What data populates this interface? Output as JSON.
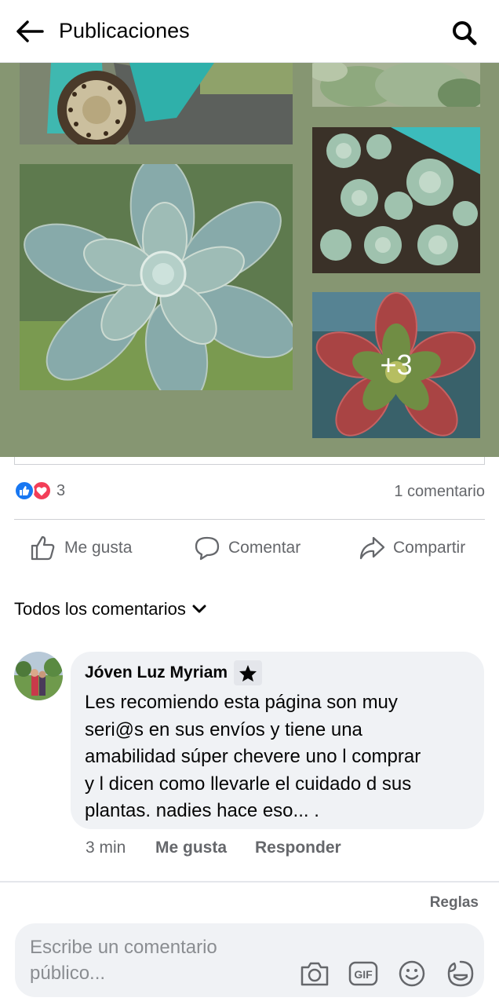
{
  "header": {
    "title": "Publicaciones"
  },
  "collage": {
    "more_label": "+3"
  },
  "post_stats": {
    "reaction_count": "3",
    "comment_count": "1 comentario"
  },
  "actions": {
    "like": "Me gusta",
    "comment": "Comentar",
    "share": "Compartir"
  },
  "comments_filter": {
    "label": "Todos los comentarios"
  },
  "comment": {
    "author": "Jóven Luz Myriam",
    "text": "Les recomiendo esta página son muy\nseri@s en sus envíos y tiene una\namabilidad  súper chevere uno l comprar\ny  l dicen como llevarle el cuidado d sus\nplantas. nadies hace eso... .",
    "time": "3 min",
    "like": "Me gusta",
    "reply": "Responder"
  },
  "rules_link": "Reglas",
  "composer": {
    "placeholder": "Escribe un comentario público..."
  },
  "colors": {
    "collage_bg": "#869672",
    "like_blue": "#1877f2",
    "love_red": "#f33e58",
    "secondary_text": "#65676b",
    "bubble_bg": "#f0f2f5"
  },
  "icons": [
    "back-arrow-icon",
    "search-icon",
    "like-reaction-icon",
    "love-reaction-icon",
    "thumbs-up-icon",
    "comment-icon",
    "share-icon",
    "chevron-down-icon",
    "star-icon",
    "camera-icon",
    "gif-icon",
    "emoji-icon",
    "sticker-icon"
  ]
}
